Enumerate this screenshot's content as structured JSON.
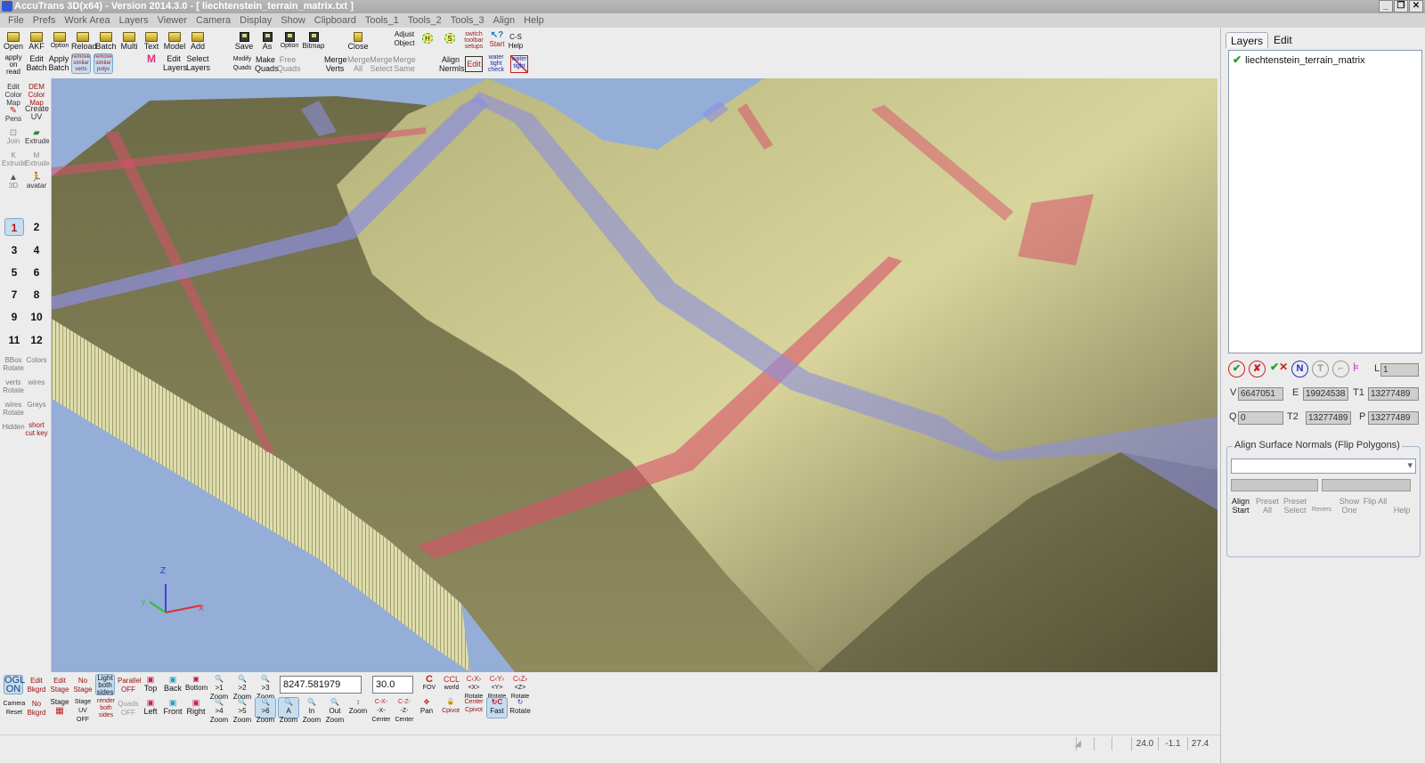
{
  "window": {
    "title": "AccuTrans 3D(x64) - Version 2014.3.0 - [ liechtenstein_terrain_matrix.txt ]",
    "controls": [
      "_",
      "❐",
      "✕"
    ]
  },
  "menu": [
    "File",
    "Prefs",
    "Work Area",
    "Layers",
    "Viewer",
    "Camera",
    "Display",
    "Show",
    "Clipboard",
    "Tools_1",
    "Tools_2",
    "Tools_3",
    "Align",
    "Help"
  ],
  "toolbar": {
    "row1": [
      {
        "label": "Open",
        "icon": "folder-icon"
      },
      {
        "label": "AKF",
        "icon": "folder-icon"
      },
      {
        "label": "Option",
        "icon": "folder-icon"
      },
      {
        "label": "Reload",
        "icon": "folder-icon"
      },
      {
        "label": "Batch",
        "icon": "folder-icon"
      },
      {
        "label": "Multi",
        "icon": "folder-icon"
      },
      {
        "label": "Text",
        "icon": "folder-icon"
      },
      {
        "label": "Model",
        "icon": "folder-icon"
      },
      {
        "label": "Add",
        "icon": "folder-icon"
      },
      {
        "label": "Save",
        "icon": "disk-icon"
      },
      {
        "label": "As",
        "icon": "disk-icon"
      },
      {
        "label": "Option",
        "icon": "disk-icon"
      },
      {
        "label": "Bitmap",
        "icon": "disk-icon"
      },
      {
        "label": "Close",
        "icon": "folder-open-icon"
      },
      {
        "label": "Adjust Object"
      },
      {
        "label": "H",
        "icon": "adjust-h-icon"
      },
      {
        "label": "S",
        "icon": "adjust-s-icon"
      },
      {
        "label": "switch toolbar setups"
      },
      {
        "label": "Start",
        "icon": "help-cursor-icon"
      },
      {
        "label": "C-S Help"
      }
    ],
    "row2": [
      {
        "label": "apply on read"
      },
      {
        "label": "Edit Batch"
      },
      {
        "label": "Apply Batch"
      },
      {
        "label": "remove similar verts"
      },
      {
        "label": "remove similar polys"
      },
      {
        "label": "M",
        "icon": "bulb-icon"
      },
      {
        "label": "Edit Layers"
      },
      {
        "label": "Select Layers"
      },
      {
        "label": "Modify Quads"
      },
      {
        "label": "Make Quads"
      },
      {
        "label": "Free Quads"
      },
      {
        "label": "Merge Verts"
      },
      {
        "label": "Merge All"
      },
      {
        "label": "Merge Select"
      },
      {
        "label": "Merge Same"
      },
      {
        "label": "Align Nermls"
      },
      {
        "label": "Edit"
      },
      {
        "label": "water tight check"
      },
      {
        "label": "water tight"
      }
    ]
  },
  "leftbar": {
    "tools": [
      {
        "label": "Edit Color Map"
      },
      {
        "label": "DEM Color Map"
      },
      {
        "label": "Pens"
      },
      {
        "label": "Create UV"
      },
      {
        "label": "Join"
      },
      {
        "label": "Extrude"
      },
      {
        "label": "K Extrude"
      },
      {
        "label": "M Extrude"
      },
      {
        "label": "3D"
      },
      {
        "label": "avatar"
      }
    ],
    "numbers": [
      "1",
      "2",
      "3",
      "4",
      "5",
      "6",
      "7",
      "8",
      "9",
      "10",
      "11",
      "12"
    ],
    "active_number": "1",
    "bottom_tools": [
      {
        "label": "BBox Rotate"
      },
      {
        "label": "Colors"
      },
      {
        "label": "verts Rotate"
      },
      {
        "label": "wires"
      },
      {
        "label": "wires Rotate"
      },
      {
        "label": "Greys"
      },
      {
        "label": "Hidden"
      },
      {
        "label": "short cut key"
      }
    ]
  },
  "viewport": {
    "axis_labels": {
      "z": "Z",
      "x": "X",
      "y": "Y"
    },
    "sky_color": "#94aed8",
    "terrain_color": "#d6d49a",
    "overlay_red": "#d8506a",
    "overlay_blue": "#8c8ee0"
  },
  "bottombar": {
    "row1": [
      {
        "label": "OGL ON",
        "selected": true
      },
      {
        "label": "Edit Bkgrd"
      },
      {
        "label": "Edit Stage"
      },
      {
        "label": "No Stage"
      },
      {
        "label": "Light both sides",
        "selected": true
      },
      {
        "label": "Parallel OFF"
      },
      {
        "label": "Top"
      },
      {
        "label": "Back"
      },
      {
        "label": "Bottom"
      },
      {
        "label": ">1 Zoom"
      },
      {
        "label": ">2 Zoom"
      },
      {
        "label": ">3 Zoom"
      },
      {
        "label": "FOV"
      },
      {
        "label": "world"
      },
      {
        "label": "<X> Rotate"
      },
      {
        "label": "<Y> Rotate"
      },
      {
        "label": "<Z> Rotate"
      }
    ],
    "row2": [
      {
        "label": "Camera Reset"
      },
      {
        "label": "No Bkgrd"
      },
      {
        "label": "Stage"
      },
      {
        "label": "Stage UV OFF"
      },
      {
        "label": "render both sides"
      },
      {
        "label": "Quads OFF"
      },
      {
        "label": "Left"
      },
      {
        "label": "Front"
      },
      {
        "label": "Right"
      },
      {
        "label": ">4 Zoom"
      },
      {
        "label": ">5 Zoom"
      },
      {
        "label": ">6 Zoom",
        "selected": true
      },
      {
        "label": "A Zoom",
        "selected": true
      },
      {
        "label": "In Zoom"
      },
      {
        "label": "Out Zoom"
      },
      {
        "label": "Zoom"
      },
      {
        "label": "-X- Center"
      },
      {
        "label": "-Z- Center"
      },
      {
        "label": "Pan"
      },
      {
        "label": "Cpivot"
      },
      {
        "label": "Center Cpivot"
      },
      {
        "label": "Fast",
        "selected": true
      },
      {
        "label": "Rotate"
      }
    ],
    "distance_value": "8247.581979",
    "fov_value": "30.0"
  },
  "statusbar": {
    "values": [
      "24.0",
      "-1.1",
      "27.4"
    ]
  },
  "rightpanel": {
    "tabs": [
      "Layers",
      "Edit"
    ],
    "active_tab": "Layers",
    "layers": [
      {
        "name": "liechtenstein_terrain_matrix",
        "visible": true
      }
    ],
    "L_label": "L",
    "L_value": "1",
    "stats": {
      "V_label": "V",
      "V": "6647051",
      "E_label": "E",
      "E": "19924538",
      "T1_label": "T1",
      "T1": "13277489",
      "Q_label": "Q",
      "Q": "0",
      "T2_label": "T2",
      "T2": "13277489",
      "P_label": "P",
      "P": "13277489"
    },
    "align_group": {
      "title": "Align Surface Normals (Flip Polygons)",
      "combo_value": "",
      "buttons": [
        "Align Start",
        "Preset All",
        "Preset Select",
        "Revers",
        "Show One",
        "Flip All",
        "Help"
      ]
    }
  }
}
